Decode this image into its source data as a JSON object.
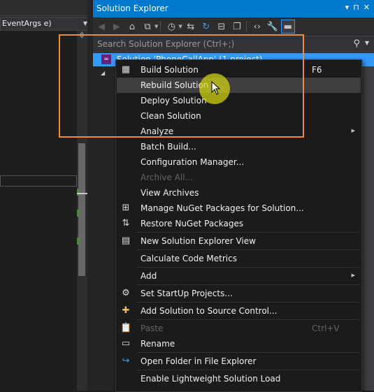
{
  "editor": {
    "combo_text": "EventArgs e)",
    "split_glyph": "⇳"
  },
  "solution_explorer": {
    "title": "Solution Explorer",
    "title_buttons": [
      "▾",
      "⊓",
      "✕"
    ],
    "search_placeholder": "Search Solution Explorer (Ctrl+;)",
    "solution_row": "Solution 'PhoneCallApp' (1 project)",
    "toolbar_icons": [
      "back-icon",
      "forward-icon",
      "home-icon",
      "sync-with-active-document-icon",
      "pending-changes-filter-icon",
      "show-all-files-icon",
      "refresh-icon",
      "collapse-all-icon",
      "properties-icon",
      "view-code-icon",
      "wrench-icon",
      "preview-selected-items-icon"
    ]
  },
  "menu": {
    "items": [
      {
        "label": "Build Solution",
        "shortcut": "F6",
        "icon": "build-icon"
      },
      {
        "label": "Rebuild Solution",
        "icon": ""
      },
      {
        "label": "Deploy Solution",
        "icon": ""
      },
      {
        "label": "Clean Solution",
        "icon": ""
      },
      {
        "label": "Analyze",
        "icon": "",
        "submenu": true
      },
      {
        "label": "Batch Build...",
        "icon": ""
      },
      {
        "label": "Configuration Manager...",
        "icon": ""
      },
      {
        "label": "Archive All...",
        "icon": "",
        "disabled": true
      },
      {
        "label": "View Archives",
        "icon": ""
      },
      {
        "label": "Manage NuGet Packages for Solution...",
        "icon": "nuget-icon"
      },
      {
        "label": "Restore NuGet Packages",
        "icon": "restore-nuget-icon"
      },
      {
        "label": "New Solution Explorer View",
        "icon": "new-view-icon"
      },
      {
        "label": "Calculate Code Metrics",
        "icon": ""
      },
      {
        "label": "Add",
        "icon": "",
        "submenu": true
      },
      {
        "label": "Set StartUp Projects...",
        "icon": "gear-icon"
      },
      {
        "label": "Add Solution to Source Control...",
        "icon": "add-source-control-icon"
      },
      {
        "label": "Paste",
        "shortcut": "Ctrl+V",
        "icon": "paste-icon",
        "disabled": true
      },
      {
        "label": "Rename",
        "icon": "rename-icon"
      },
      {
        "label": "Open Folder in File Explorer",
        "icon": "open-folder-icon"
      },
      {
        "label": "Enable Lightweight Solution Load",
        "icon": ""
      }
    ]
  },
  "colors": {
    "accent": "#007acc",
    "selection": "#3399ff",
    "highlight_box": "#f08b3a",
    "cursor_halo": "#d7d714"
  }
}
